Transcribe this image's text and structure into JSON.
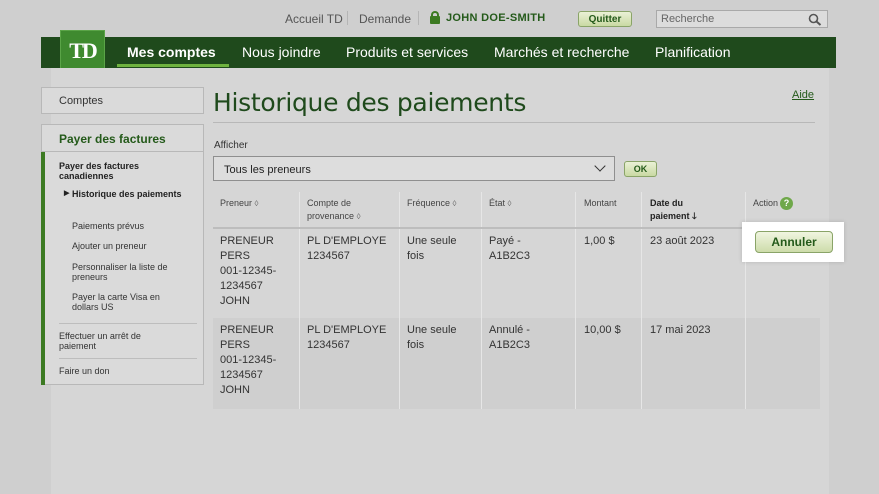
{
  "topbar": {
    "home_link": "Accueil TD",
    "request_link": "Demande",
    "username": "JOHN DOE-SMITH",
    "quit_label": "Quitter",
    "search_placeholder": "Recherche"
  },
  "brand": {
    "logo_text": "TD",
    "colors": {
      "nav_green": "#1f4a1c",
      "accent_green": "#3c7a22",
      "logo_green": "#3f8a2f"
    }
  },
  "nav": {
    "items": [
      "Mes comptes",
      "Nous joindre",
      "Produits et services",
      "Marchés et recherche",
      "Planification"
    ],
    "active": "Mes comptes"
  },
  "sidebar": {
    "comptes": "Comptes",
    "payer_header": "Payer des factures",
    "items": [
      "Payer des factures canadiennes",
      "Historique des paiements",
      "Paiements prévus",
      "Ajouter un preneur",
      "Personnaliser la liste de preneurs",
      "Payer la carte Visa en dollars US",
      "Effectuer un arrêt de paiement",
      "Faire un don"
    ],
    "current": "Historique des paiements"
  },
  "main": {
    "title": "Historique des paiements",
    "help_link": "Aide",
    "filter_label": "Afficher",
    "filter_value": "Tous les preneurs",
    "ok_label": "OK"
  },
  "table": {
    "headers": {
      "preneur": "Preneur",
      "compte": "Compte de provenance",
      "frequence": "Fréquence",
      "etat": "État",
      "montant": "Montant",
      "date": "Date du paiement",
      "action": "Action"
    },
    "rows": [
      {
        "preneur": [
          "PRENEUR",
          "PERS",
          "001-12345-",
          "1234567",
          "JOHN"
        ],
        "compte": [
          "PL D'EMPLOYE",
          "1234567"
        ],
        "frequence": [
          "Une seule",
          "fois"
        ],
        "etat": [
          "Payé -",
          "A1B2C3"
        ],
        "montant": "1,00 $",
        "date": "23 août 2023",
        "action": "Annuler"
      },
      {
        "preneur": [
          "PRENEUR",
          "PERS",
          "001-12345-",
          "1234567",
          "JOHN"
        ],
        "compte": [
          "PL D'EMPLOYE",
          "1234567"
        ],
        "frequence": [
          "Une seule",
          "fois"
        ],
        "etat": [
          "Annulé -",
          "A1B2C3"
        ],
        "montant": "10,00 $",
        "date": "17 mai 2023",
        "action": ""
      }
    ]
  }
}
